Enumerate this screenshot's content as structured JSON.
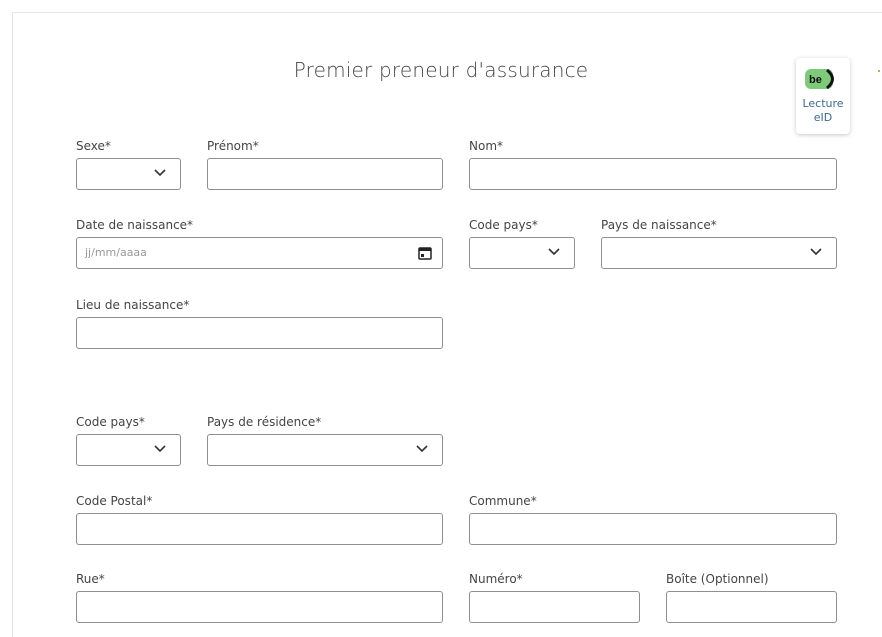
{
  "title": "Premier preneur d'assurance",
  "eid_button": {
    "badge": "be",
    "label_line1": "Lecture",
    "label_line2": "eID"
  },
  "fields": {
    "sexe": {
      "label": "Sexe*"
    },
    "prenom": {
      "label": "Prénom*"
    },
    "nom": {
      "label": "Nom*"
    },
    "date_naissance": {
      "label": "Date de naissance*",
      "placeholder": "jj/mm/aaaa"
    },
    "code_pays_naissance": {
      "label": "Code pays*"
    },
    "pays_naissance": {
      "label": "Pays de naissance*"
    },
    "lieu_naissance": {
      "label": "Lieu de naissance*"
    },
    "code_pays_residence": {
      "label": "Code pays*"
    },
    "pays_residence": {
      "label": "Pays de résidence*"
    },
    "code_postal": {
      "label": "Code Postal*"
    },
    "commune": {
      "label": "Commune*"
    },
    "rue": {
      "label": "Rue*"
    },
    "numero": {
      "label": "Numéro*"
    },
    "boite": {
      "label": "Boîte (Optionnel)"
    }
  },
  "colors": {
    "border": "#8f8f8f",
    "eid_green": "#7fc97a",
    "eid_text": "#3b6b8c"
  }
}
